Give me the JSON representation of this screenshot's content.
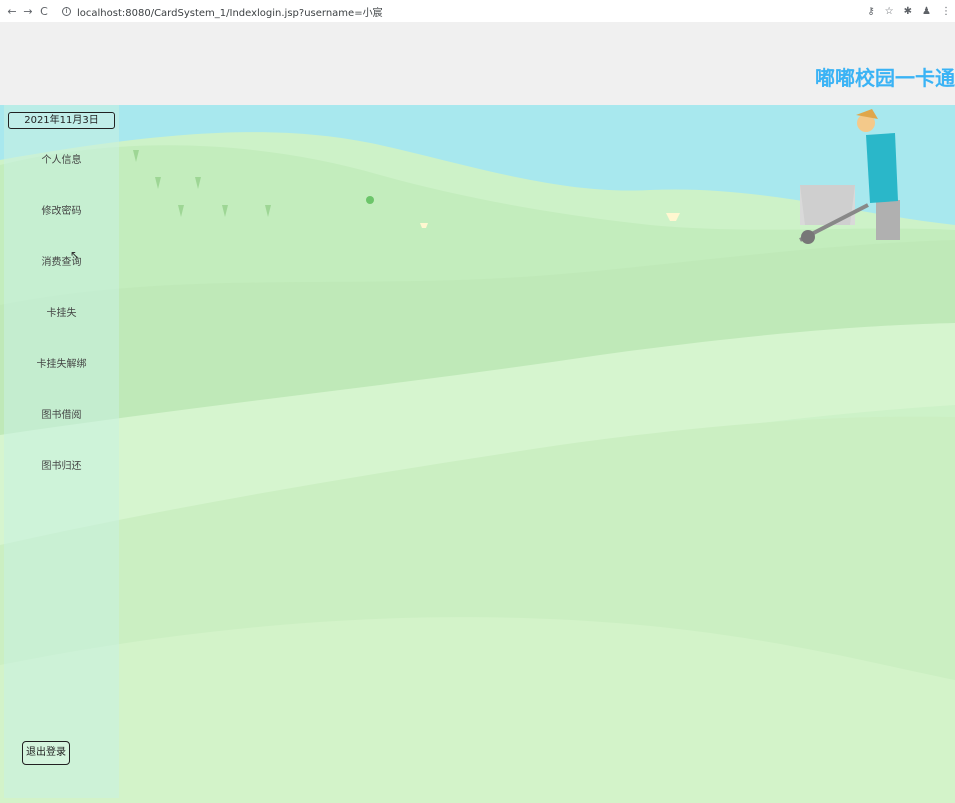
{
  "browser": {
    "back_icon": "←",
    "forward_icon": "→",
    "reload_icon": "C",
    "info_icon": "i",
    "url": "localhost:8080/CardSystem_1/Indexlogin.jsp?username=小宸",
    "key_icon": "⚷",
    "star_icon": "☆",
    "extension_icon": "✱",
    "profile_icon": "♟",
    "menu_icon": "⋮"
  },
  "header": {
    "title": "嘟嘟校园一卡通系统"
  },
  "sidebar": {
    "date": "2021年11月3日",
    "menu": [
      {
        "label": "个人信息"
      },
      {
        "label": "修改密码"
      },
      {
        "label": "消费查询"
      },
      {
        "label": "卡挂失"
      },
      {
        "label": "卡挂失解绑"
      },
      {
        "label": "图书借阅"
      },
      {
        "label": "图书归还"
      }
    ],
    "logout_label": "退出登录"
  },
  "colors": {
    "title": "#3ab3f5",
    "sky": "#a8e8ee",
    "grass": "#cdf2c8",
    "header_bg": "#f0f0f0"
  }
}
